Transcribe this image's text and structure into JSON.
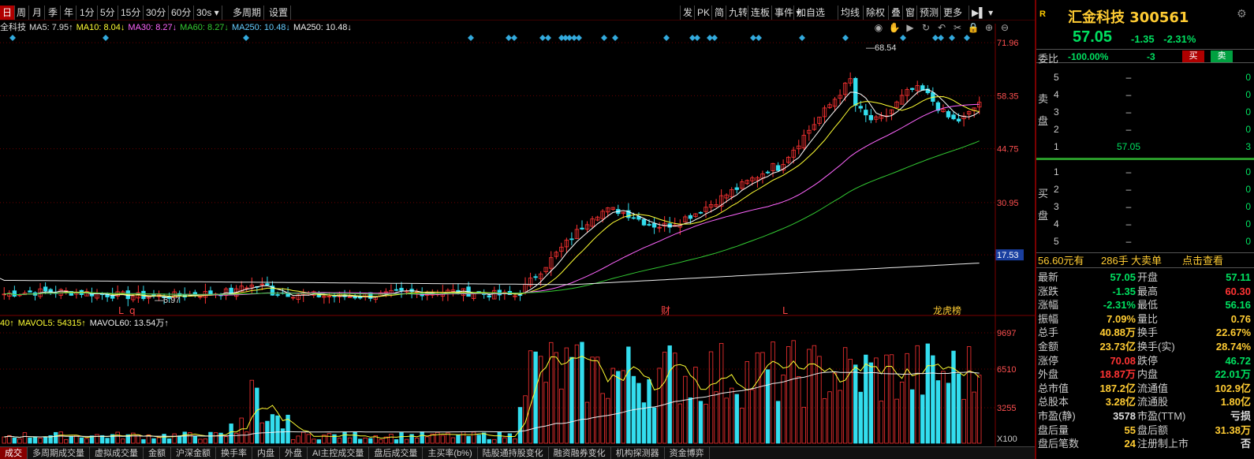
{
  "toolbar": {
    "periods": [
      "日",
      "周",
      "月",
      "季",
      "年",
      "1分",
      "5分",
      "15分",
      "30分",
      "60分",
      "30s",
      "多周期",
      "设置"
    ],
    "active_period": "日",
    "right_tools": [
      "发",
      "PK",
      "简",
      "九转",
      "连板",
      "事件",
      "加自选",
      "均线",
      "除权",
      "叠",
      "窗",
      "预测",
      "更多"
    ]
  },
  "ma_legend": [
    {
      "label": "全科技",
      "color": "#dddddd"
    },
    {
      "label": "MA5: 7.95↑",
      "color": "#dddddd"
    },
    {
      "label": "MA10: 8.04↓",
      "color": "#ffff33"
    },
    {
      "label": "MA30: 8.27↓",
      "color": "#ff66ff"
    },
    {
      "label": "MA60: 8.27↓",
      "color": "#33cc33"
    },
    {
      "label": "MA250: 10.48↓",
      "color": "#66ccff"
    },
    {
      "label": "MA250: 10.48↓",
      "color": "#eeeeee"
    }
  ],
  "vol_legend": [
    {
      "label": "40↑",
      "color": "#ffff33"
    },
    {
      "label": "MAVOL5: 54315↑",
      "color": "#ffff33"
    },
    {
      "label": "MAVOL60: 13.54万↑",
      "color": "#eeeeee"
    }
  ],
  "chart_data": {
    "type": "candlestick",
    "price_axis": [
      "71.96",
      "58.35",
      "44.75",
      "30.95",
      "17.53"
    ],
    "current_level": "17.53",
    "volume_axis": [
      "9697",
      "6510",
      "3255",
      "X100"
    ],
    "max_label": "68.54",
    "min_label": "6.97",
    "event_markers": [
      "L",
      "q",
      "财",
      "L",
      "龙虎榜"
    ],
    "ylim": [
      3,
      74
    ]
  },
  "bottom_tabs": [
    "成交",
    "多周期成交量",
    "虚拟成交量",
    "金额",
    "沪深金额",
    "换手率",
    "内盘",
    "外盘",
    "AI主控成交量",
    "盘后成交量",
    "主买率(b%)",
    "陆股通持股变化",
    "融资融券变化",
    "机构探测器",
    "资金博弈"
  ],
  "quote": {
    "market_tag": "R",
    "name": "汇金科技",
    "code": "300561",
    "price": "57.05",
    "change": "-1.35",
    "change_pct": "-2.31%",
    "webi_label": "委比",
    "webi_value": "-100.00%",
    "webi_diff": "-3",
    "buy_btn": "买",
    "sell_btn": "卖",
    "sell_side_label": "卖盘",
    "buy_side_label": "买盘",
    "asks": [
      {
        "level": "5",
        "price": "–",
        "qty": "0"
      },
      {
        "level": "4",
        "price": "–",
        "qty": "0"
      },
      {
        "level": "3",
        "price": "–",
        "qty": "0"
      },
      {
        "level": "2",
        "price": "–",
        "qty": "0"
      },
      {
        "level": "1",
        "price": "57.05",
        "qty": "3"
      }
    ],
    "bids": [
      {
        "level": "1",
        "price": "–",
        "qty": "0"
      },
      {
        "level": "2",
        "price": "–",
        "qty": "0"
      },
      {
        "level": "3",
        "price": "–",
        "qty": "0"
      },
      {
        "level": "4",
        "price": "–",
        "qty": "0"
      },
      {
        "level": "5",
        "price": "–",
        "qty": "0"
      }
    ],
    "mid": {
      "price": "56.60元有",
      "vol": "286手",
      "big": "大卖单",
      "link": "点击查看"
    },
    "stats": [
      {
        "l1": "最新",
        "v1": "57.05",
        "c1": "g",
        "l2": "开盘",
        "v2": "57.11",
        "c2": "g"
      },
      {
        "l1": "涨跌",
        "v1": "-1.35",
        "c1": "g",
        "l2": "最高",
        "v2": "60.30",
        "c2": "r"
      },
      {
        "l1": "涨幅",
        "v1": "-2.31%",
        "c1": "g",
        "l2": "最低",
        "v2": "56.16",
        "c2": "g"
      },
      {
        "l1": "振幅",
        "v1": "7.09%",
        "c1": "y",
        "l2": "量比",
        "v2": "0.76",
        "c2": "y"
      },
      {
        "l1": "总手",
        "v1": "40.88万",
        "c1": "y",
        "l2": "换手",
        "v2": "22.67%",
        "c2": "y"
      },
      {
        "l1": "金额",
        "v1": "23.73亿",
        "c1": "y",
        "l2": "换手(实)",
        "v2": "28.74%",
        "c2": "y"
      },
      {
        "l1": "涨停",
        "v1": "70.08",
        "c1": "r",
        "l2": "跌停",
        "v2": "46.72",
        "c2": "g"
      },
      {
        "l1": "外盘",
        "v1": "18.87万",
        "c1": "r",
        "l2": "内盘",
        "v2": "22.01万",
        "c2": "g"
      },
      {
        "l1": "总市值",
        "v1": "187.2亿",
        "c1": "y",
        "l2": "流通值",
        "v2": "102.9亿",
        "c2": "y"
      },
      {
        "l1": "总股本",
        "v1": "3.28亿",
        "c1": "y",
        "l2": "流通股",
        "v2": "1.80亿",
        "c2": "y"
      },
      {
        "l1": "市盈(静)",
        "v1": "3578",
        "c1": "w",
        "l2": "市盈(TTM)",
        "v2": "亏损",
        "c2": "w"
      },
      {
        "l1": "盘后量",
        "v1": "55",
        "c1": "y",
        "l2": "盘后额",
        "v2": "31.38万",
        "c2": "y"
      },
      {
        "l1": "盘后笔数",
        "v1": "24",
        "c1": "y",
        "l2": "注册制上市",
        "v2": "否",
        "c2": "w"
      }
    ]
  }
}
